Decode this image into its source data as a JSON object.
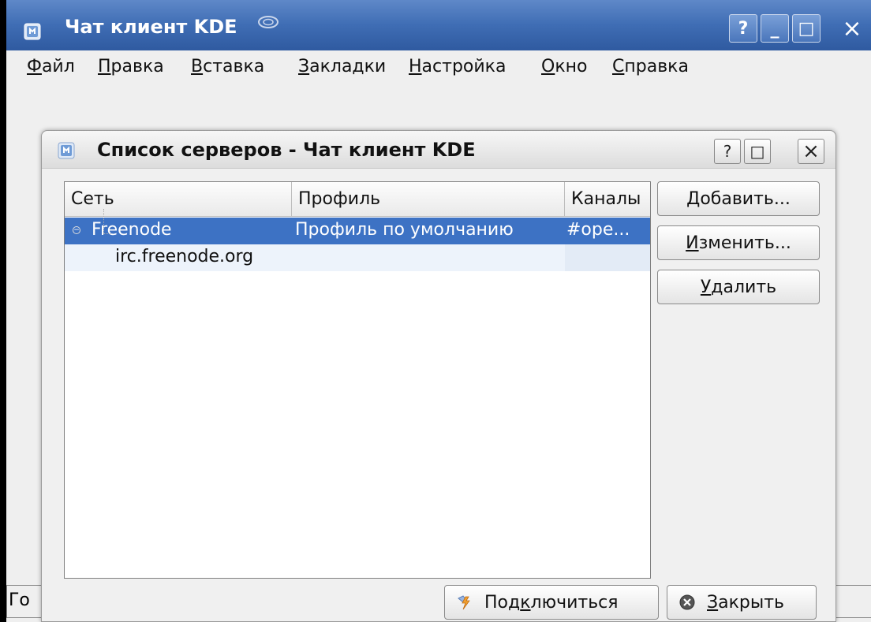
{
  "main_window": {
    "title": "Чат клиент KDE",
    "title_buttons": {
      "help": "?",
      "minimize": "_",
      "maximize": "□",
      "close": "×"
    },
    "menu": [
      {
        "first": "Ф",
        "rest": "айл"
      },
      {
        "first": "П",
        "rest": "равка"
      },
      {
        "first": "В",
        "rest": "ставка"
      },
      {
        "first": "З",
        "rest": "акладки"
      },
      {
        "first": "Н",
        "rest": "астройка"
      },
      {
        "first": "О",
        "rest": "кно"
      },
      {
        "first": "С",
        "rest": "правка"
      }
    ],
    "statusbar_text": "Го"
  },
  "dialog": {
    "title": "Список серверов - Чат клиент KDE",
    "title_buttons": {
      "help": "?",
      "maximize": "□",
      "close": "×"
    },
    "columns": [
      "Сеть",
      "Профиль",
      "Каналы"
    ],
    "rows": [
      {
        "network": "Freenode",
        "profile": "Профиль по умолчанию",
        "channels": "#ope...",
        "selected": true
      },
      {
        "network": "irc.freenode.org",
        "profile": "",
        "channels": "",
        "selected": false
      }
    ],
    "side_buttons": {
      "add": "Добавить...",
      "edit_first": "И",
      "edit_rest": "зменить...",
      "delete_first": "У",
      "delete_rest": "далить"
    },
    "bottom_buttons": {
      "connect_pre": "Под",
      "connect_ul": "к",
      "connect_post": "лючиться",
      "close_first": "З",
      "close_rest": "акрыть"
    }
  },
  "colors": {
    "titlebar": "#3f6db4",
    "selection": "#3d72c4",
    "alt_row": "#edf3fb"
  }
}
